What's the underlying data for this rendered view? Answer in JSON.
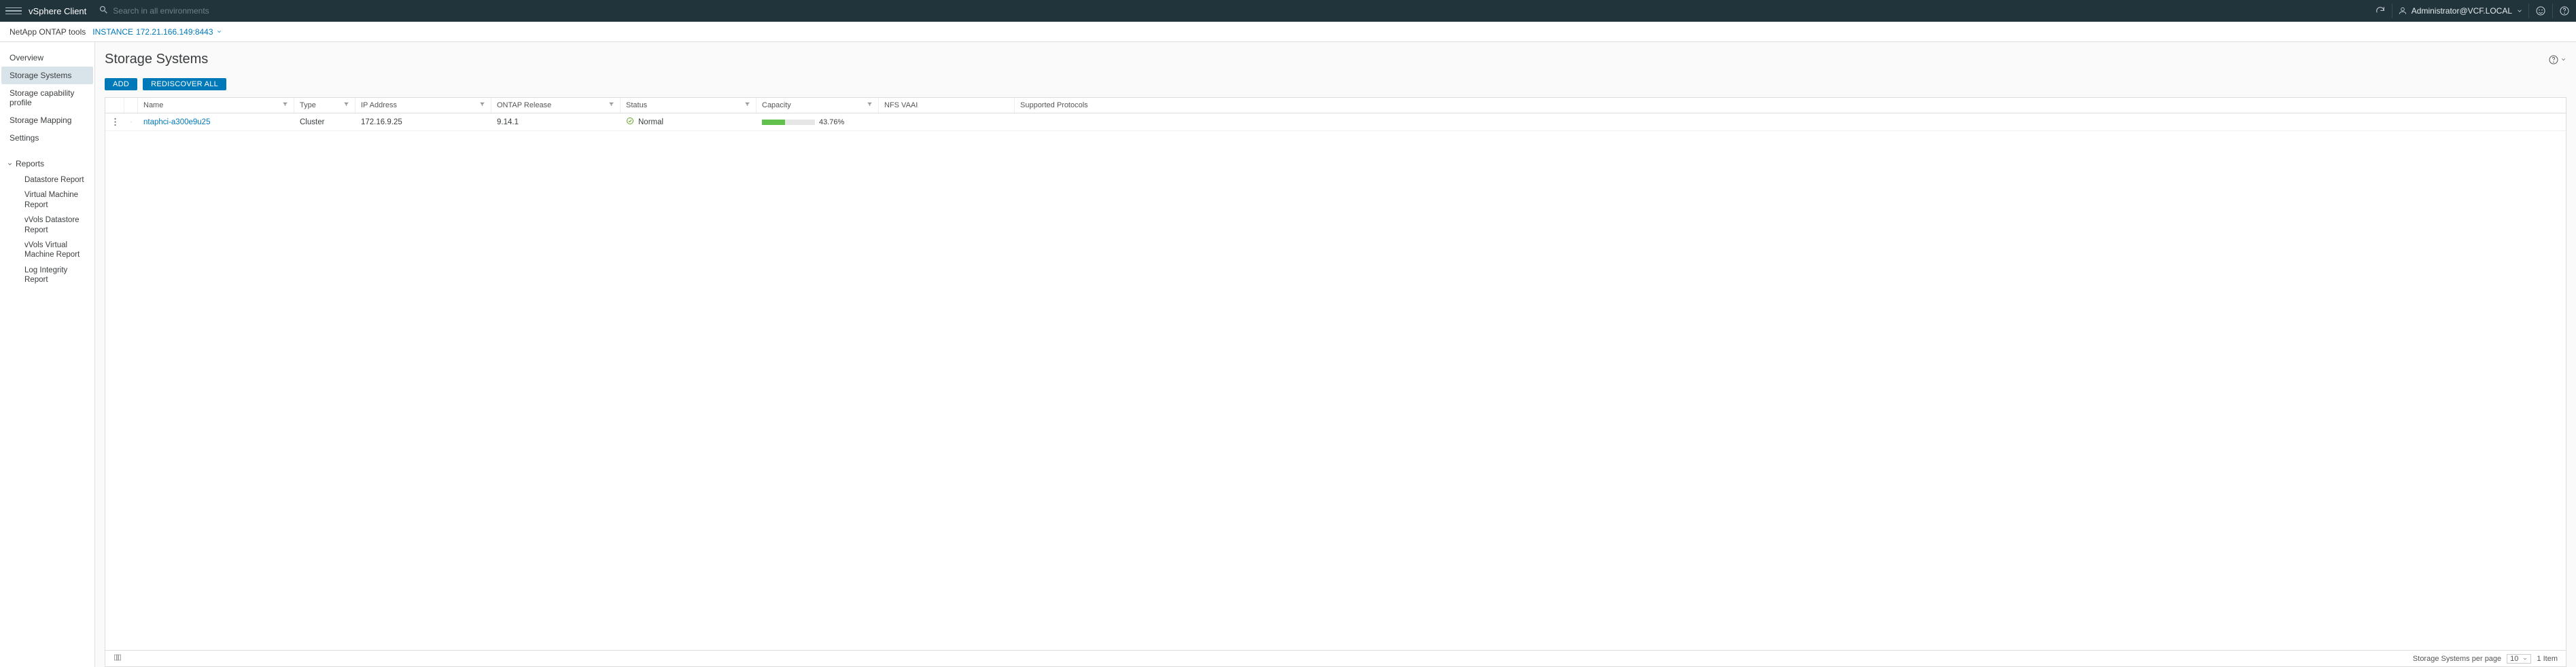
{
  "header": {
    "app_title": "vSphere Client",
    "search_placeholder": "Search in all environments",
    "user_label": "Administrator@VCF.LOCAL"
  },
  "subheader": {
    "plugin_name": "NetApp ONTAP tools",
    "instance_prefix": "INSTANCE",
    "instance_addr": "172.21.166.149:8443"
  },
  "sidebar": {
    "items": [
      {
        "label": "Overview",
        "active": false
      },
      {
        "label": "Storage Systems",
        "active": true
      },
      {
        "label": "Storage capability profile",
        "active": false
      },
      {
        "label": "Storage Mapping",
        "active": false
      },
      {
        "label": "Settings",
        "active": false
      }
    ],
    "reports_header": "Reports",
    "reports": [
      "Datastore Report",
      "Virtual Machine Report",
      "vVols Datastore Report",
      "vVols Virtual Machine Report",
      "Log Integrity Report"
    ]
  },
  "main": {
    "page_title": "Storage Systems",
    "add_label": "ADD",
    "rediscover_label": "REDISCOVER ALL",
    "columns": {
      "name": "Name",
      "type": "Type",
      "ip": "IP Address",
      "release": "ONTAP Release",
      "status": "Status",
      "capacity": "Capacity",
      "nfs_vaai": "NFS VAAI",
      "protocols": "Supported Protocols"
    },
    "rows": [
      {
        "name": "ntaphci-a300e9u25",
        "type": "Cluster",
        "ip": "172.16.9.25",
        "release": "9.14.1",
        "status_text": "Normal",
        "capacity_pct": 43.76,
        "capacity_text": "43.76%",
        "nfs_vaai": "",
        "protocols": ""
      }
    ],
    "footer": {
      "per_page_label": "Storage Systems per page",
      "per_page_value": "10",
      "item_count": "1 Item"
    }
  }
}
